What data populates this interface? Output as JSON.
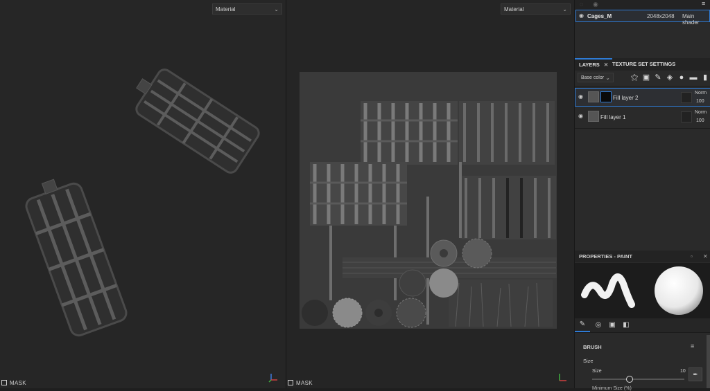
{
  "viewport3d": {
    "material_dropdown": "Material",
    "mask_label": "MASK"
  },
  "viewport2d": {
    "material_dropdown": "Material",
    "mask_label": "MASK"
  },
  "texture_set": {
    "name": "Cages_M",
    "resolution": "2048x2048",
    "shader": "Main shader"
  },
  "layers_panel": {
    "tabs": [
      "LAYERS",
      "TEXTURE SET SETTINGS"
    ],
    "channel_dropdown": "Base color",
    "layers": [
      {
        "name": "Fill layer 2",
        "blend": "Norm",
        "opacity": "100"
      },
      {
        "name": "Fill layer 1",
        "blend": "Norm",
        "opacity": "100"
      }
    ]
  },
  "properties": {
    "title": "PROPERTIES - PAINT",
    "brush_header": "BRUSH",
    "size_group": "Size",
    "size_label": "Size",
    "size_value": "10",
    "next_label": "Minimum Size (%)",
    "size_fraction": 0.4
  },
  "colors": {
    "accent": "#2e7bd6",
    "panel": "#2a2a2a",
    "viewport": "#262626"
  }
}
